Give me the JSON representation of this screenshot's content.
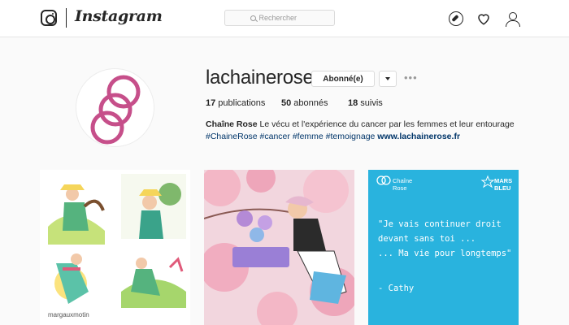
{
  "header": {
    "wordmark": "Instagram",
    "search": {
      "placeholder": "Rechercher"
    }
  },
  "profile": {
    "username": "lachainerose",
    "follow_label": "Abonné(e)",
    "more_label": "•••",
    "stats": [
      {
        "count": "17",
        "label": " publications"
      },
      {
        "count": "50",
        "label": " abonnés"
      },
      {
        "count": "18",
        "label": " suivis"
      }
    ],
    "bio": {
      "name": "Chaîne Rose",
      "text": " Le vécu et l'expérience du cancer par les femmes et leur entourage",
      "tags": "#ChaineRose #cancer #femme #temoignage ",
      "link": "www.lachainerose.fr"
    },
    "avatar_color": "#c64f8a"
  },
  "posts": [
    {
      "type": "illustration",
      "user": "margauxmotin"
    },
    {
      "type": "illustration"
    },
    {
      "type": "quote",
      "brand_line1": "Chaîne",
      "brand_line2": "Rose",
      "mars_line1": "MARS",
      "mars_line2": "BLEU",
      "quote": "\"Je vais continuer droit\ndevant sans toi ...\n... Ma vie pour longtemps\"",
      "author": "- Cathy",
      "bg_color": "#29b3de"
    }
  ]
}
